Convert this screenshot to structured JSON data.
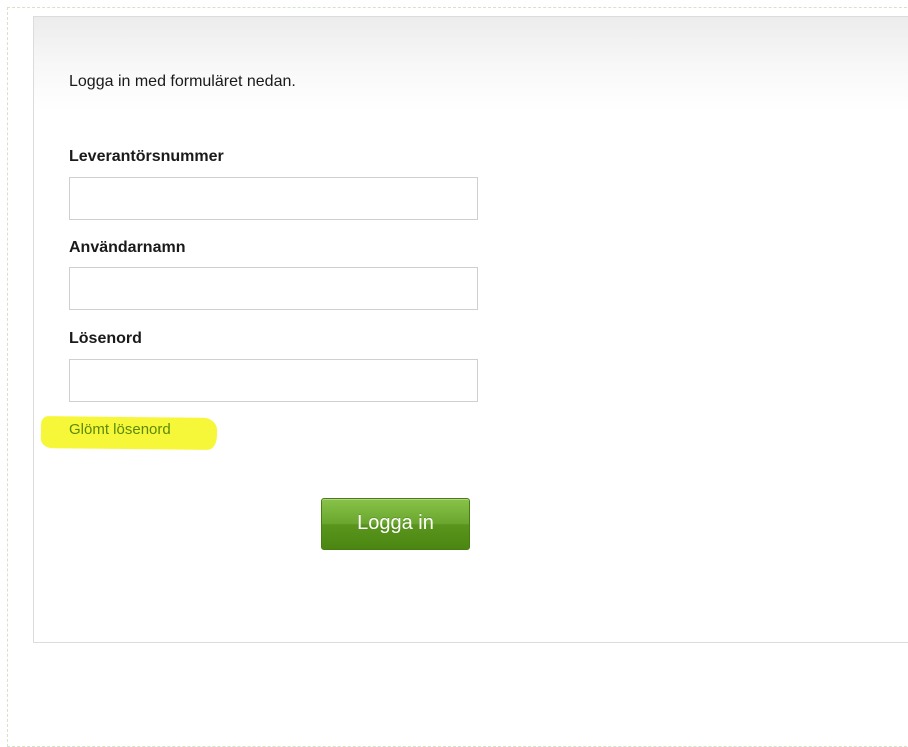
{
  "login_form": {
    "intro": "Logga in med formuläret nedan.",
    "fields": [
      {
        "label": "Leverantörsnummer",
        "value": "",
        "placeholder": ""
      },
      {
        "label": "Användarnamn",
        "value": "",
        "placeholder": ""
      },
      {
        "label": "Lösenord",
        "value": "",
        "placeholder": ""
      }
    ],
    "forgot_password": "Glömt lösenord",
    "submit_label": "Logga in"
  },
  "colors": {
    "accent_green": "#5b8a08",
    "button_green": "#6aa62d",
    "highlight_yellow": "#f7f73a"
  }
}
